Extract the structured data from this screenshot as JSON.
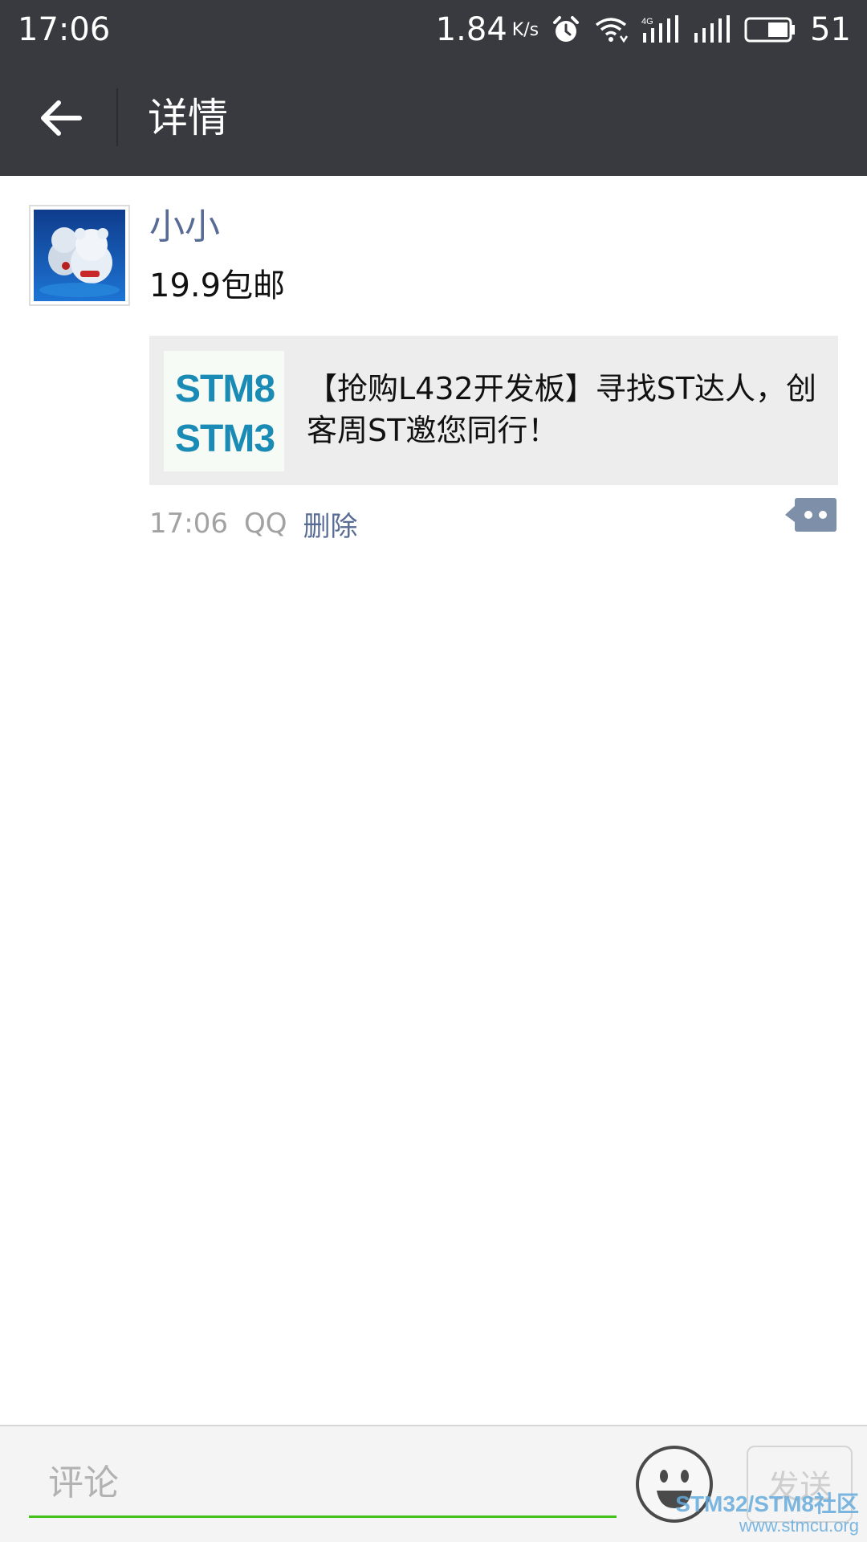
{
  "status_bar": {
    "time": "17:06",
    "net_speed": "1.84",
    "net_unit": "K/s",
    "battery": "51",
    "icons": [
      "alarm-icon",
      "wifi-icon",
      "signal-4g-icon",
      "signal-icon",
      "battery-icon"
    ]
  },
  "header": {
    "back_icon": "arrow-left-icon",
    "title": "详情"
  },
  "post": {
    "username": "小小",
    "text": "19.9包邮",
    "link": {
      "thumb_line1": "STM8",
      "thumb_line2": "STM3",
      "title": "【抢购L432开发板】寻找ST达人，创客周ST邀您同行！"
    },
    "time": "17:06",
    "source": "QQ",
    "delete_label": "删除",
    "comment_icon": "comment-bubble-icon"
  },
  "comment_bar": {
    "placeholder": "评论",
    "emoji_icon": "emoji-icon",
    "send_label": "发送"
  },
  "watermark": {
    "main": "STM32/STM8社区",
    "sub": "www.stmcu.org"
  },
  "colors": {
    "header_bg": "#393a3f",
    "link_blue": "#576b95",
    "input_underline": "#45c01a",
    "card_bg": "#ededed"
  }
}
